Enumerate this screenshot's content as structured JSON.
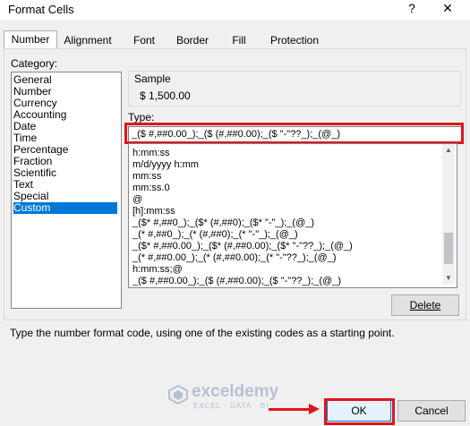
{
  "window": {
    "title": "Format Cells",
    "help_glyph": "?",
    "close_glyph": "✕"
  },
  "tabs": [
    "Number",
    "Alignment",
    "Font",
    "Border",
    "Fill",
    "Protection"
  ],
  "category": {
    "label": "Category:",
    "items": [
      "General",
      "Number",
      "Currency",
      "Accounting",
      "Date",
      "Time",
      "Percentage",
      "Fraction",
      "Scientific",
      "Text",
      "Special",
      "Custom"
    ],
    "selected": "Custom"
  },
  "sample": {
    "label": "Sample",
    "value": "$ 1,500.00"
  },
  "type": {
    "label": "Type:",
    "value": "_($ #,##0.00_);_($ (#,##0.00);_($ \"-\"??_);_(@_)"
  },
  "formats": [
    "h:mm:ss",
    "m/d/yyyy h:mm",
    "mm:ss",
    "mm:ss.0",
    "@",
    "[h]:mm:ss",
    "_($* #,##0_);_($* (#,##0);_($* \"-\"_);_(@_)",
    "_(* #,##0_);_(* (#,##0);_(* \"-\"_);_(@_)",
    "_($* #,##0.00_);_($* (#,##0.00);_($* \"-\"??_);_(@_)",
    "_(* #,##0.00_);_(* (#,##0.00);_(* \"-\"??_);_(@_)",
    "h:mm:ss;@",
    "_($ #,##0.00_);_($ (#,##0.00);_($ \"-\"??_);_(@_)"
  ],
  "buttons": {
    "delete": "Delete",
    "ok": "OK",
    "cancel": "Cancel"
  },
  "hint": "Type the number format code, using one of the existing codes as a starting point.",
  "watermark": {
    "name": "exceldemy",
    "tagline": "EXCEL · DATA · BI"
  },
  "colors": {
    "accent": "#0078d7",
    "highlight": "#e3131a"
  }
}
